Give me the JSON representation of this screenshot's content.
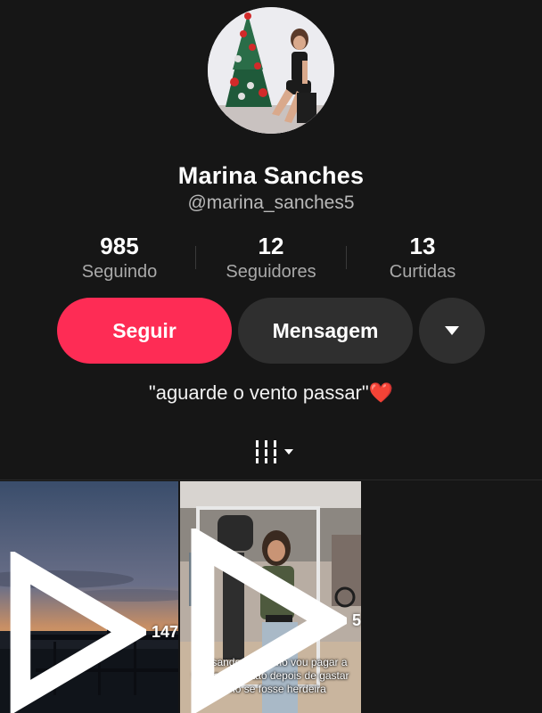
{
  "profile": {
    "name": "Marina Sanches",
    "handle": "@marina_sanches5",
    "bio": "\"aguarde o vento passar\"",
    "bio_emoji": "❤️"
  },
  "stats": [
    {
      "num": "985",
      "label": "Seguindo"
    },
    {
      "num": "12",
      "label": "Seguidores"
    },
    {
      "num": "13",
      "label": "Curtidas"
    }
  ],
  "actions": {
    "follow": "Seguir",
    "message": "Mensagem"
  },
  "videos": [
    {
      "views": "147",
      "caption": ""
    },
    {
      "views": "5",
      "caption": "pensando em como vou pagar a fatura do cartão depois de gastar como se fosse herdeira"
    }
  ],
  "colors": {
    "accent": "#fe2c55",
    "background": "#161616",
    "button_dark": "#2f2f2f"
  }
}
